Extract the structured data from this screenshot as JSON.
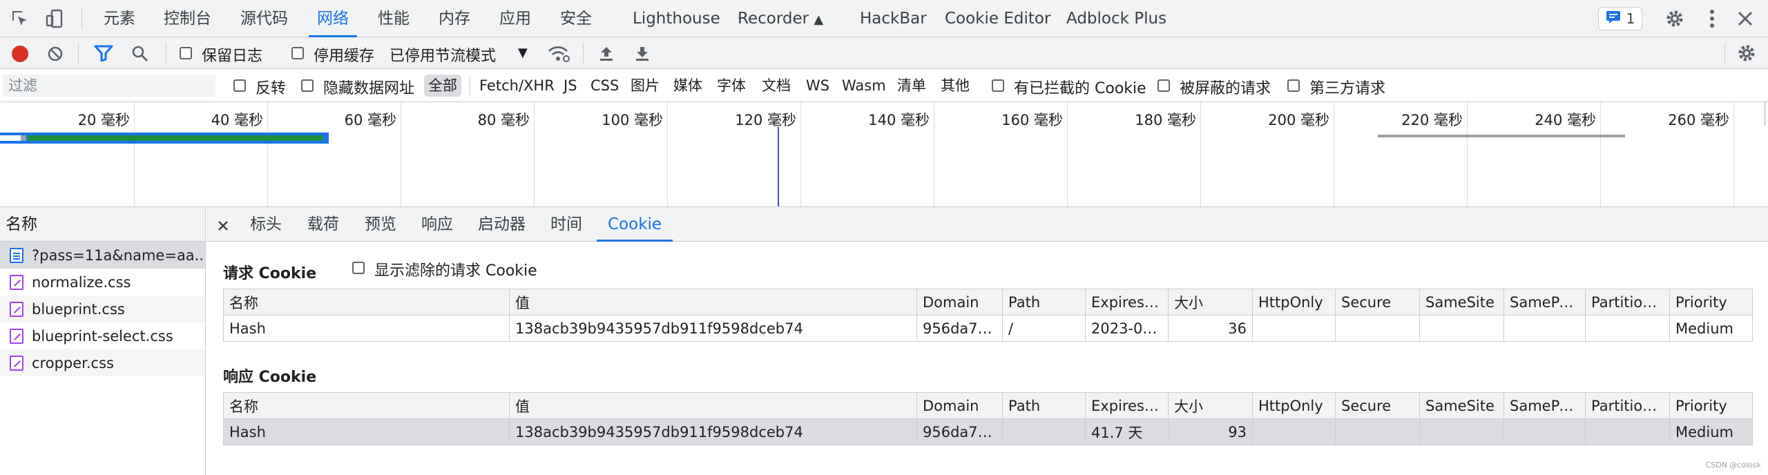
{
  "top_tabs": [
    "元素",
    "控制台",
    "源代码",
    "网络",
    "性能",
    "内存",
    "应用",
    "安全",
    "Lighthouse",
    "Recorder",
    "HackBar",
    "Cookie Editor",
    "Adblock Plus"
  ],
  "active_top_tab": "网络",
  "issues_count": "1",
  "toolbar": {
    "preserve_log": "保留日志",
    "disable_cache": "停用缓存",
    "throttling": "已停用节流模式"
  },
  "filter": {
    "placeholder": "过滤",
    "invert": "反转",
    "hide_data_urls": "隐藏数据网址",
    "types": [
      "全部",
      "Fetch/XHR",
      "JS",
      "CSS",
      "图片",
      "媒体",
      "字体",
      "文档",
      "WS",
      "Wasm",
      "清单",
      "其他"
    ],
    "blocked_cookies": "有已拦截的 Cookie",
    "blocked_requests": "被屏蔽的请求",
    "third_party": "第三方请求"
  },
  "timeline": {
    "ticks": [
      "20 毫秒",
      "40 毫秒",
      "60 毫秒",
      "80 毫秒",
      "100 毫秒",
      "120 毫秒",
      "140 毫秒",
      "160 毫秒",
      "180 毫秒",
      "200 毫秒",
      "220 毫秒",
      "240 毫秒",
      "260 毫秒"
    ]
  },
  "request_list": {
    "header": "名称",
    "items": [
      "?pass=11a&name=aa...",
      "normalize.css",
      "blueprint.css",
      "blueprint-select.css",
      "cropper.css"
    ]
  },
  "details": {
    "tabs": [
      "标头",
      "载荷",
      "预览",
      "响应",
      "启动器",
      "时间",
      "Cookie"
    ],
    "active_tab": "Cookie",
    "request_cookies": {
      "title": "请求 Cookie",
      "show_filtered": "显示滤除的请求 Cookie",
      "columns": [
        "名称",
        "值",
        "Domain",
        "Path",
        "Expires /...",
        "大小",
        "HttpOnly",
        "Secure",
        "SameSite",
        "SamePar...",
        "Partition ...",
        "Priority"
      ],
      "rows": [
        [
          "Hash",
          "138acb39b9435957db911f9598dceb74",
          "956da75...",
          "/",
          "2023-03...",
          "36",
          "",
          "",
          "",
          "",
          "",
          "Medium"
        ]
      ]
    },
    "response_cookies": {
      "title": "响应 Cookie",
      "columns": [
        "名称",
        "值",
        "Domain",
        "Path",
        "Expires /...",
        "大小",
        "HttpOnly",
        "Secure",
        "SameSite",
        "SamePar...",
        "Partition ...",
        "Priority"
      ],
      "rows": [
        [
          "Hash",
          "138acb39b9435957db911f9598dceb74",
          "956da75...",
          "",
          "41.7 天",
          "93",
          "",
          "",
          "",
          "",
          "",
          "Medium"
        ]
      ]
    }
  },
  "watermark": "CSDN @colosk",
  "colors": {
    "accent": "#1a73e8",
    "record": "#d93025",
    "waterfall_green": "#1e8e3e",
    "waterfall_blue": "#1a73e8"
  }
}
